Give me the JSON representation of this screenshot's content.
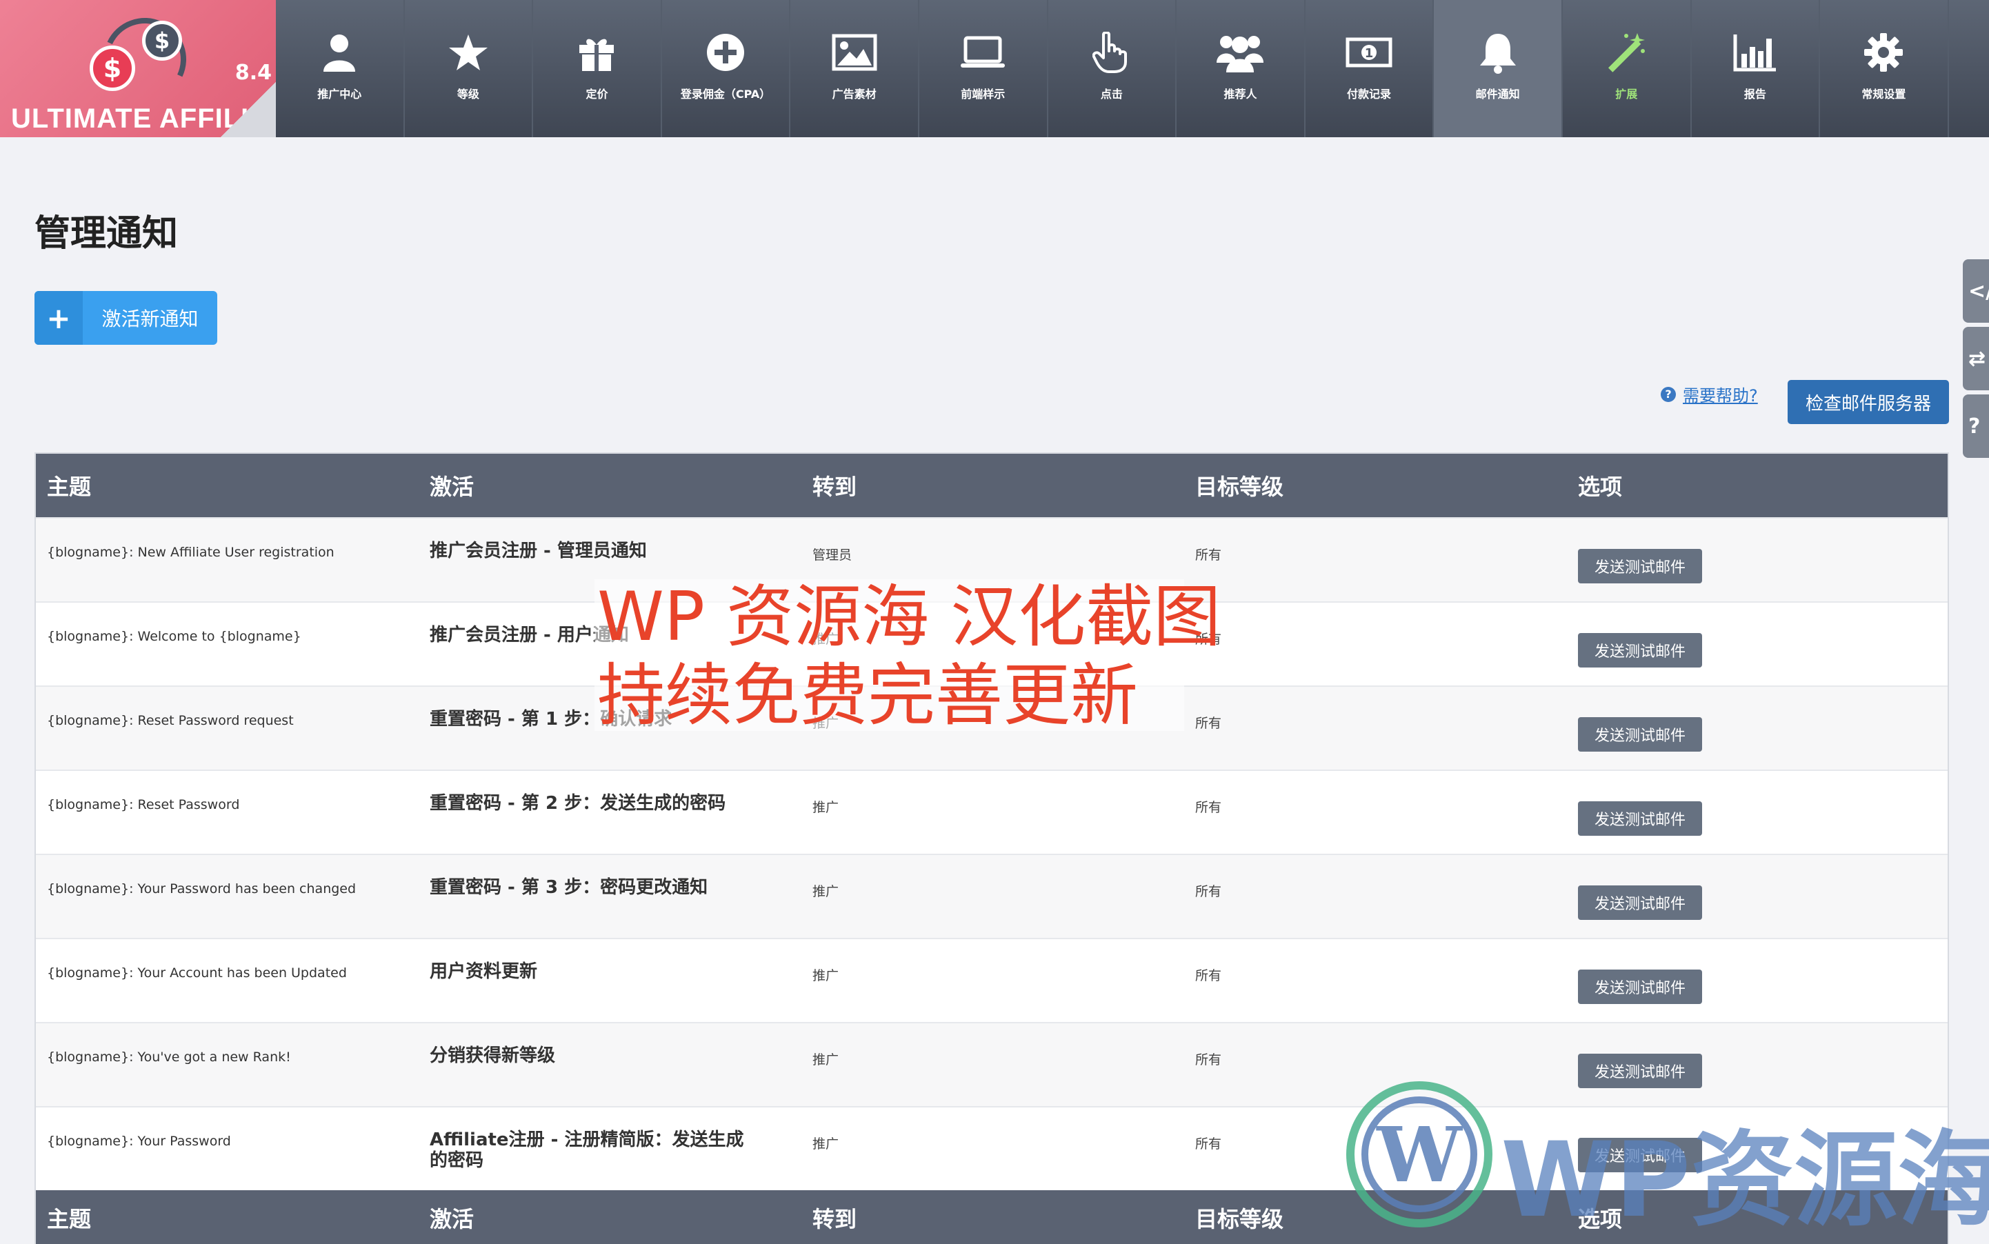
{
  "app": {
    "version": "8.4",
    "brand": "ULTIMATE AFFILIATE",
    "colors": {
      "logo_bg": "#e66a80",
      "topbar": "#4d5563",
      "primary_button": "#3aa0ef",
      "dark_button": "#2f6fb3",
      "accent_green": "#9fe37a"
    }
  },
  "nav": [
    {
      "label": "推广中心",
      "icon": "user-icon"
    },
    {
      "label": "等级",
      "icon": "star-icon"
    },
    {
      "label": "定价",
      "icon": "gift-icon"
    },
    {
      "label": "登录佣金（CPA）",
      "icon": "plus-circle-icon"
    },
    {
      "label": "广告素材",
      "icon": "image-icon"
    },
    {
      "label": "前端样示",
      "icon": "laptop-icon"
    },
    {
      "label": "点击",
      "icon": "pointer-hand-icon"
    },
    {
      "label": "推荐人",
      "icon": "users-icon"
    },
    {
      "label": "付款记录",
      "icon": "money-icon"
    },
    {
      "label": "邮件通知",
      "icon": "bell-icon",
      "active": true
    },
    {
      "label": "扩展",
      "icon": "magic-wand-icon"
    },
    {
      "label": "报告",
      "icon": "bar-chart-icon"
    },
    {
      "label": "常规设置",
      "icon": "gear-icon"
    }
  ],
  "page": {
    "title": "管理通知",
    "activate_button": "激活新通知",
    "help_link": "需要帮助?",
    "check_server_button": "检查邮件服务器"
  },
  "table": {
    "headers": [
      "主题",
      "激活",
      "转到",
      "目标等级",
      "选项"
    ],
    "test_button": "发送测试邮件",
    "rows": [
      {
        "subject": "{blogname}: New Affiliate User registration",
        "action": "推广会员注册 - 管理员通知",
        "to": "管理员",
        "rank": "所有"
      },
      {
        "subject": "{blogname}: Welcome to {blogname}",
        "action": "推广会员注册 - 用户通知",
        "to": "推广",
        "rank": "所有"
      },
      {
        "subject": "{blogname}: Reset Password request",
        "action": "重置密码 - 第 1 步：确认请求",
        "to": "推广",
        "rank": "所有"
      },
      {
        "subject": "{blogname}: Reset Password",
        "action": "重置密码 - 第 2 步：发送生成的密码",
        "to": "推广",
        "rank": "所有"
      },
      {
        "subject": "{blogname}: Your Password has been changed",
        "action": "重置密码 - 第 3 步：密码更改通知",
        "to": "推广",
        "rank": "所有"
      },
      {
        "subject": "{blogname}: Your Account has been Updated",
        "action": "用户资料更新",
        "to": "推广",
        "rank": "所有"
      },
      {
        "subject": "{blogname}: You've got a new Rank!",
        "action": "分销获得新等级",
        "to": "推广",
        "rank": "所有"
      },
      {
        "subject": "{blogname}: Your Password",
        "action": "Affiliate注册 - 注册精简版：发送生成的密码",
        "to": "推广",
        "rank": "所有"
      }
    ]
  },
  "side_tabs": [
    "</",
    "⇄",
    "?"
  ],
  "watermark": {
    "line1": "WP 资源海 汉化截图",
    "line2": "持续免费完善更新",
    "brand": "WP资源海"
  }
}
